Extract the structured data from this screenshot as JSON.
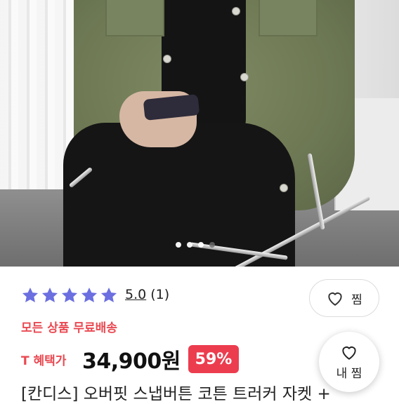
{
  "gallery": {
    "total_images": 4,
    "current_index": 0
  },
  "rating": {
    "stars": 5,
    "score": "5.0",
    "count": "(1)",
    "star_color": "#6b6fe0"
  },
  "wishlist": {
    "label": "찜"
  },
  "shipping": {
    "label": "모든 상품 무료배송"
  },
  "price": {
    "benefit_label": "T 혜택가",
    "amount": "34,900원",
    "discount": "59%",
    "accent": "#ec3d4f"
  },
  "product": {
    "title": "[칸디스] 오버핏 스냅버튼 코튼 트러커 자켓 +"
  },
  "floating": {
    "label": "내 찜"
  }
}
